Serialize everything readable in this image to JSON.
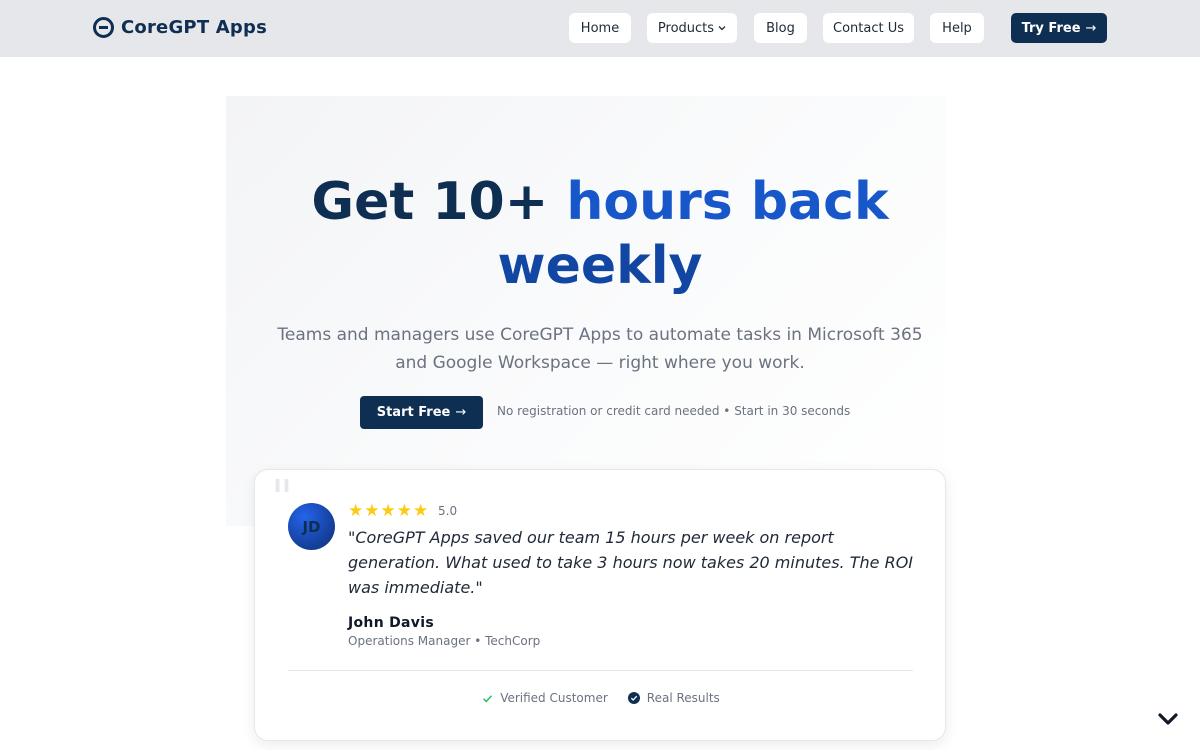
{
  "header": {
    "brand": "CoreGPT Apps",
    "nav": {
      "home": "Home",
      "products": "Products",
      "blog": "Blog",
      "contact": "Contact Us",
      "help": "Help"
    },
    "cta": "Try Free",
    "cta_arrow": "→"
  },
  "hero": {
    "title_part1": "Get 10+",
    "title_part2": "hours back",
    "title_part3": "weekly",
    "subtitle": "Teams and managers use CoreGPT Apps to automate tasks in Microsoft 365 and Google Workspace — right where you work.",
    "start_button": "Start Free",
    "start_arrow": "→",
    "note": "No registration or credit card needed • Start in 30 seconds"
  },
  "testimonial": {
    "quote_mark": "\"",
    "avatar_initials": "JD",
    "rating": "5.0",
    "stars": [
      "★",
      "★",
      "★",
      "★",
      "★"
    ],
    "quote": "\"CoreGPT Apps saved our team 15 hours per week on report generation. What used to take 3 hours now takes 20 minutes. The ROI was immediate.\"",
    "author": "John Davis",
    "role": "Operations Manager • TechCorp",
    "badge_verified": "Verified Customer",
    "badge_results": "Real Results"
  },
  "colors": {
    "brand_navy": "#0f2f52",
    "accent_blue": "#1757c9",
    "star_yellow": "#facc15",
    "check_green": "#22c55e"
  },
  "icons": {
    "logo": "brand-logo-icon",
    "chevron": "chevron-down-icon",
    "arrow": "arrow-right-icon",
    "star": "star-icon",
    "check": "check-icon",
    "verified": "verified-badge-icon",
    "scroll": "scroll-down-chevron-icon"
  }
}
